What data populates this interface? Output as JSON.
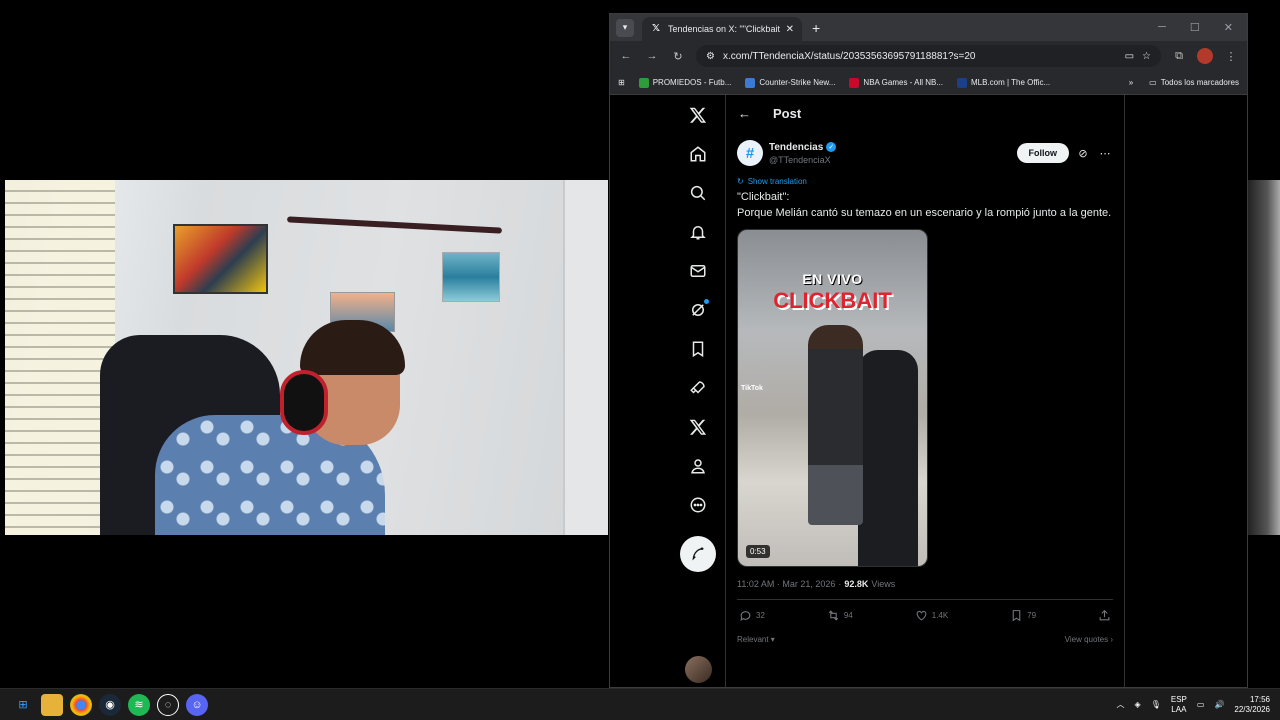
{
  "browser": {
    "tab_title": "Tendencias on X: \"\"Clickbait\": P",
    "url": "x.com/TTendenciaX/status/2035356369579118881?s=20",
    "bookmarks": [
      {
        "label": "PROMIEDOS - Futb...",
        "color": "#2e9c3a"
      },
      {
        "label": "Counter-Strike New...",
        "color": "#3a7bd5"
      },
      {
        "label": "NBA Games - All NB...",
        "color": "#c9082a"
      },
      {
        "label": "MLB.com | The Offic...",
        "color": "#1c3f8a"
      }
    ],
    "all_bookmarks": "Todos los marcadores"
  },
  "post": {
    "header_title": "Post",
    "author_name": "Tendencias",
    "author_handle": "@TTendenciaX",
    "avatar_glyph": "#",
    "follow_label": "Follow",
    "show_translation": "Show translation",
    "text_line1": "\"Clickbait\":",
    "text_line2": "Porque Melián cantó su temazo en un escenario y la rompió junto a la gente.",
    "media": {
      "overlay_line1": "EN VIVO",
      "overlay_line2": "CLICKBAIT",
      "watermark": "TikTok",
      "duration": "0:53"
    },
    "timestamp": "11:02 AM · Mar 21, 2026",
    "separator": "·",
    "views_count": "92.8K",
    "views_label": "Views",
    "replies": "32",
    "reposts": "94",
    "likes": "1.4K",
    "bookmarks": "79",
    "sort_label": "Relevant",
    "view_quotes": "View quotes"
  },
  "taskbar": {
    "lang1": "ESP",
    "lang2": "LAA",
    "time": "17:56",
    "date": "22/3/2026"
  }
}
